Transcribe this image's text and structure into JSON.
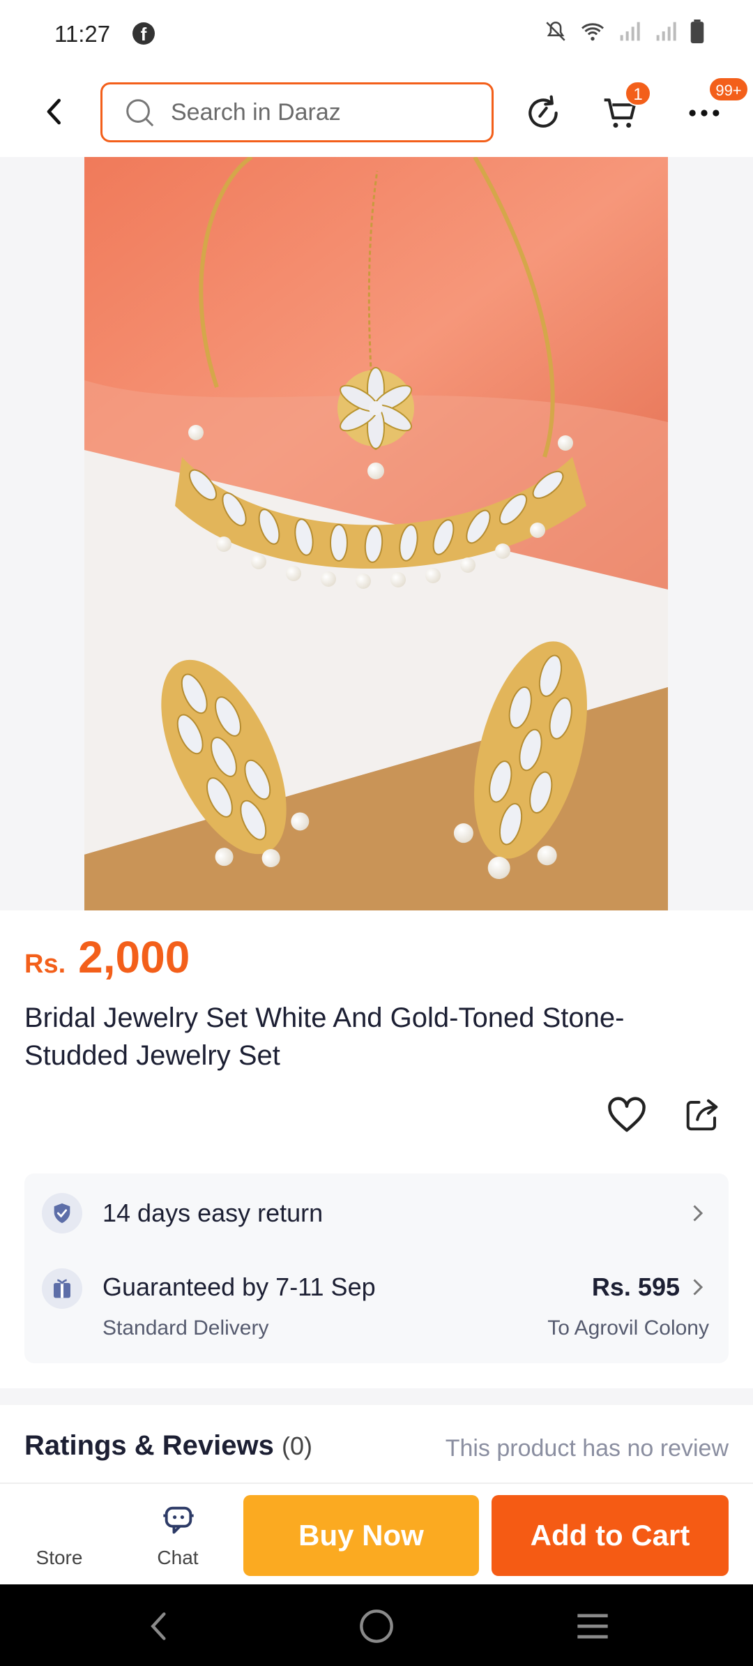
{
  "status_bar": {
    "time": "11:27",
    "fb_glyph": "f",
    "icons": [
      "facebook-icon",
      "mute-bell-icon",
      "wifi-icon",
      "signal-icon",
      "signal-icon",
      "battery-icon"
    ]
  },
  "header": {
    "search_placeholder": "Search in Daraz",
    "cart_badge": "1",
    "more_badge": "99+",
    "accent_color": "#f35f1a"
  },
  "product": {
    "currency": "Rs.",
    "price": "2,000",
    "title": "Bridal Jewelry Set White And Gold-Toned Stone-Studded Jewelry Set"
  },
  "services": {
    "return_text": "14 days easy return",
    "delivery_text": "Guaranteed by 7-11 Sep",
    "delivery_type": "Standard Delivery",
    "delivery_price": "Rs. 595",
    "delivery_location": "To Agrovil Colony"
  },
  "ratings": {
    "title": "Ratings & Reviews",
    "count": "(0)",
    "empty_text": "This product has no review"
  },
  "actions": {
    "store_label": "Store",
    "chat_label": "Chat",
    "buy_now_label": "Buy Now",
    "add_to_cart_label": "Add to Cart",
    "buy_color": "#fbaa21",
    "cart_color": "#f55b14"
  }
}
